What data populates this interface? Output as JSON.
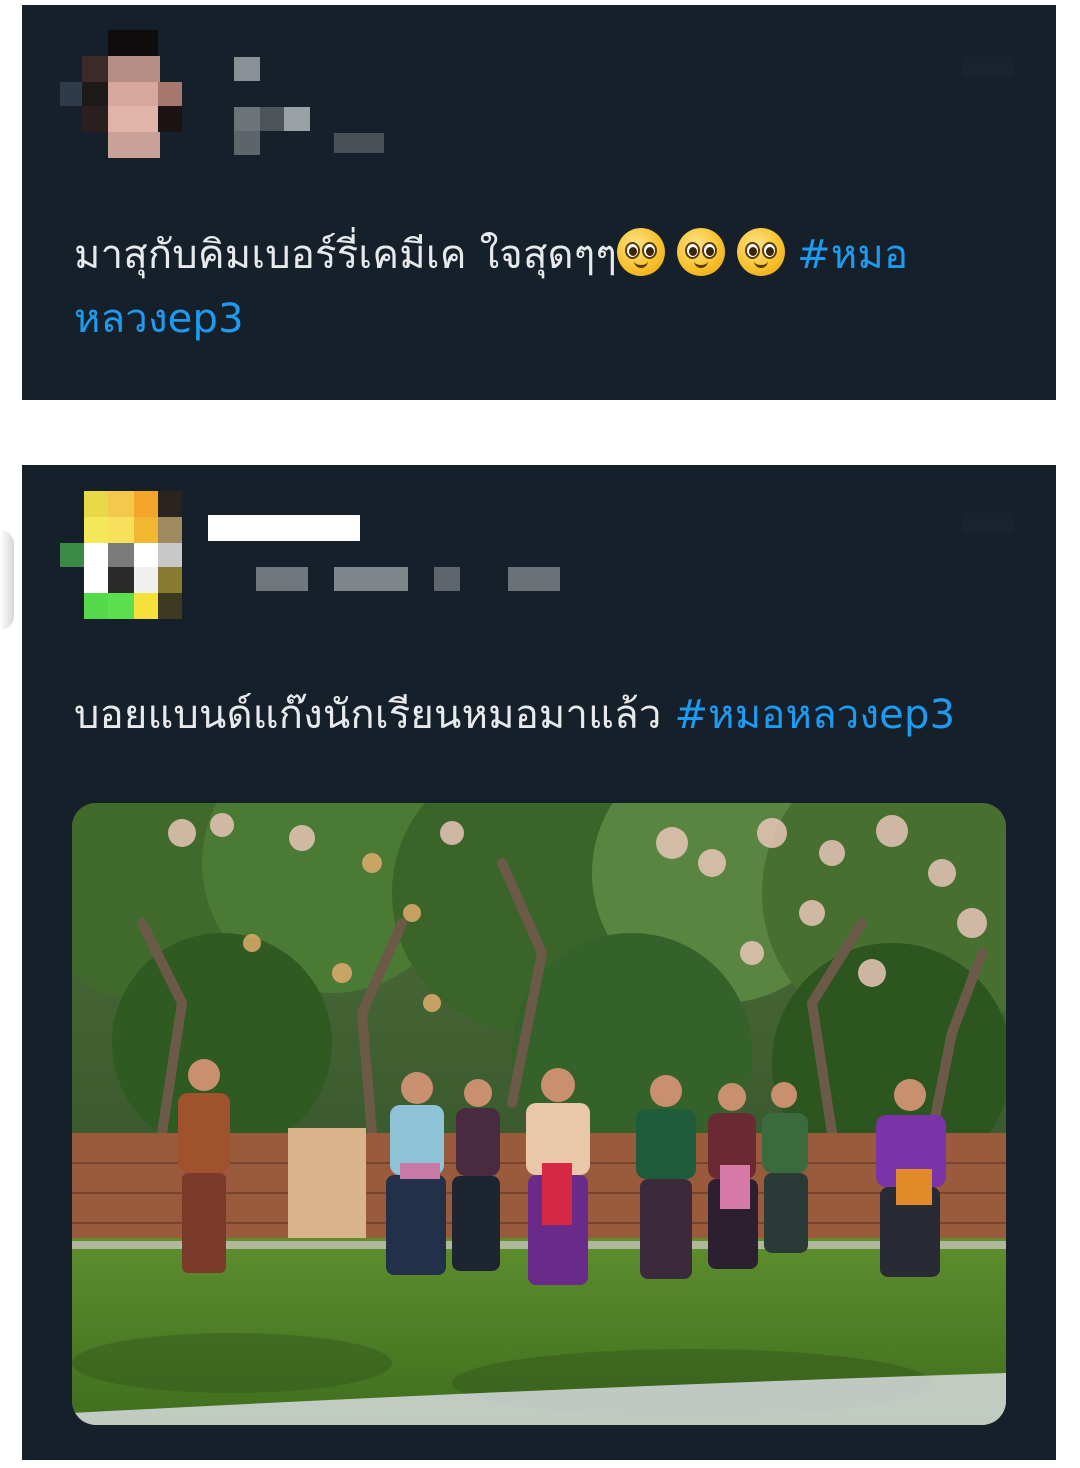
{
  "posts": [
    {
      "text": "มาสุกับคิมเบอร์รี่เคมีเค ใจสุดๆๆ",
      "emoji_name": "pleading-face-icon",
      "emoji_count": 3,
      "hashtag_part1": "#หมอ",
      "hashtag_part2": "หลวงep3"
    },
    {
      "text": "บอยแบนด์แก๊งนักเรียนหมอมาแล้ว",
      "hashtag": "#หมอหลวงep3",
      "image_description": ""
    }
  ],
  "colors": {
    "card_background": "#15202b",
    "text": "#e7e9ea",
    "hashtag": "#1d9bf0",
    "page_background": "#ffffff"
  }
}
